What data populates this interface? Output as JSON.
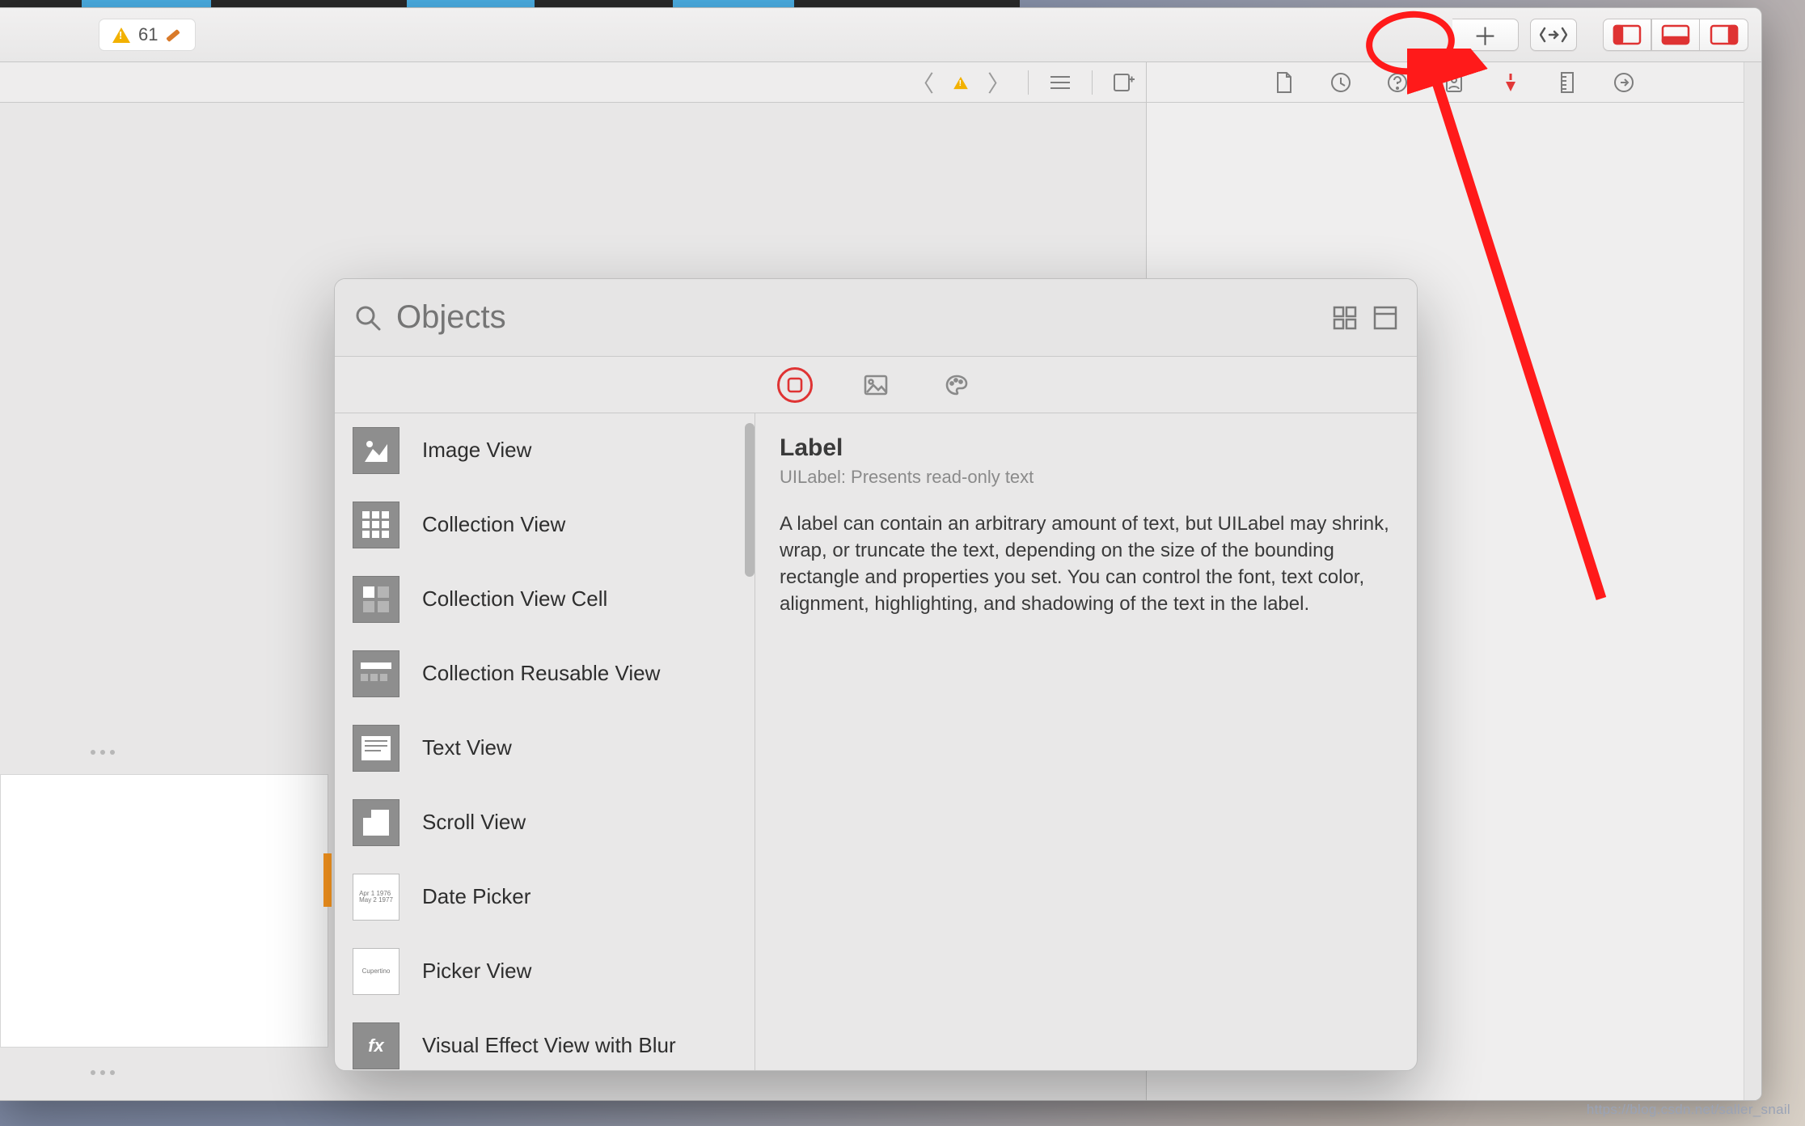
{
  "toolbar": {
    "issue_count": "61"
  },
  "library": {
    "search_placeholder": "Objects",
    "items": [
      {
        "label": "Image View"
      },
      {
        "label": "Collection View"
      },
      {
        "label": "Collection View Cell"
      },
      {
        "label": "Collection Reusable View"
      },
      {
        "label": "Text View"
      },
      {
        "label": "Scroll View"
      },
      {
        "label": "Date Picker"
      },
      {
        "label": "Picker View"
      },
      {
        "label": "Visual Effect View with Blur"
      }
    ],
    "detail": {
      "title": "Label",
      "subtitle": "UILabel: Presents read-only text",
      "description": "A label can contain an arbitrary amount of text, but UILabel may shrink, wrap, or truncate the text, depending on the size of the bounding rectangle and properties you set. You can control the font, text color, alignment, highlighting, and shadowing of the text in the label."
    }
  },
  "watermark": "https://blog.csdn.net/saller_snail"
}
